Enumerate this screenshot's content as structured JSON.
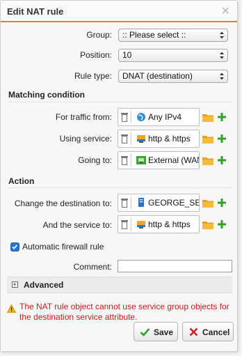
{
  "dialog": {
    "title": "Edit NAT rule",
    "close_glyph": "✕"
  },
  "form": {
    "group_label": "Group:",
    "group_value": ":: Please select ::",
    "position_label": "Position:",
    "position_value": "10",
    "rule_type_label": "Rule type:",
    "rule_type_value": "DNAT (destination)"
  },
  "matching": {
    "heading": "Matching condition",
    "traffic_label": "For traffic from:",
    "traffic_value": "Any IPv4",
    "service_label": "Using service:",
    "service_value": "http & https",
    "going_label": "Going to:",
    "going_value": "External (WAN"
  },
  "action": {
    "heading": "Action",
    "dest_label": "Change the destination to:",
    "dest_value": "GEORGE_SE",
    "svc_label": "And the service to:",
    "svc_value": "http & https"
  },
  "auto_rule": {
    "label": "Automatic firewall rule",
    "checked": true
  },
  "comment": {
    "label": "Comment:",
    "value": ""
  },
  "advanced": {
    "label": "Advanced"
  },
  "warning": {
    "text": "The NAT rule object cannot use service group objects for the destination service attribute."
  },
  "buttons": {
    "save": "Save",
    "cancel": "Cancel"
  },
  "colors": {
    "accent": "#e5801b",
    "error": "#d01818",
    "plus": "#2aa52a",
    "checkbox": "#2a74d4"
  },
  "icons": [
    "trash-icon",
    "globe-icon",
    "service-icon",
    "network-icon",
    "host-icon",
    "folder-icon",
    "plus-icon",
    "warning-icon",
    "check-icon",
    "cross-icon"
  ]
}
